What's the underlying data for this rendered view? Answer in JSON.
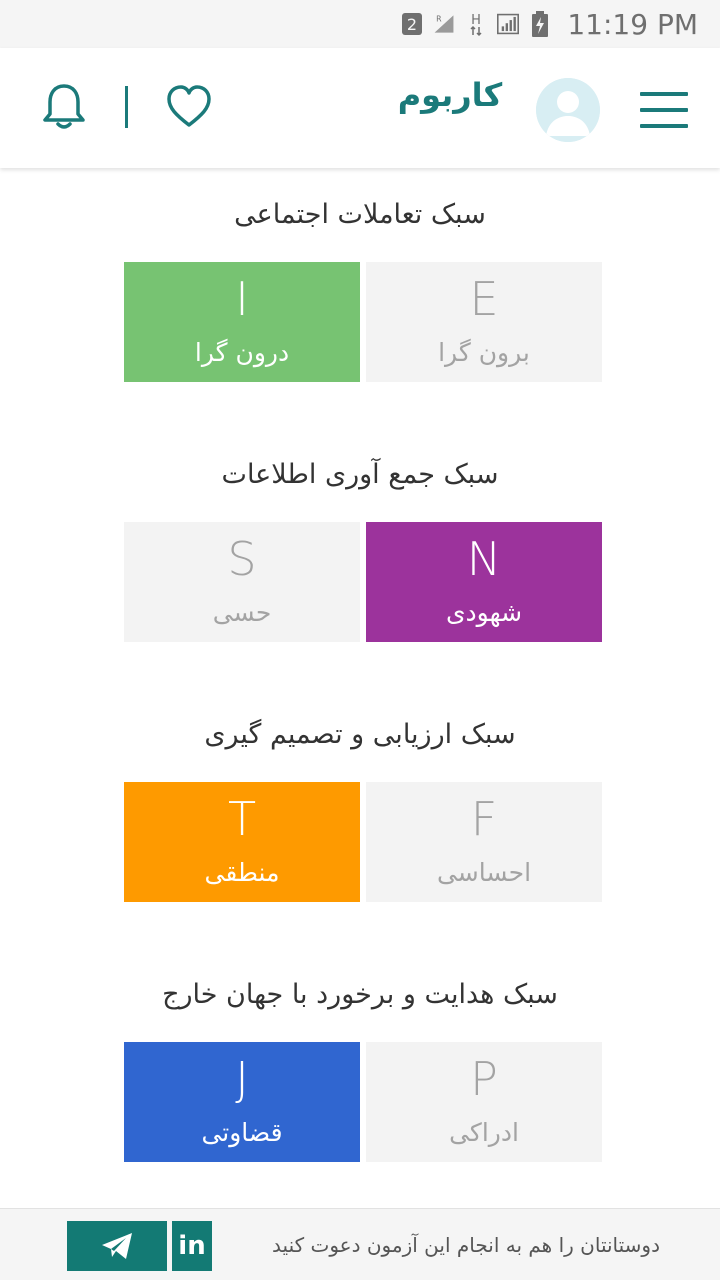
{
  "status_bar": {
    "sim_badge": "2",
    "roaming": "R",
    "network": "H",
    "time": "11:19 PM"
  },
  "app_bar": {
    "logo_text": "کاربوم",
    "accent_color": "#1b7a7a"
  },
  "sections": [
    {
      "title": "سبک تعاملات اجتماعی",
      "options": [
        {
          "letter": "I",
          "label": "درون گرا",
          "selected": true,
          "color": "#77c372"
        },
        {
          "letter": "E",
          "label": "برون گرا",
          "selected": false,
          "color": "#f3f3f3"
        }
      ]
    },
    {
      "title": "سبک جمع آوری اطلاعات",
      "options": [
        {
          "letter": "S",
          "label": "حسی",
          "selected": false,
          "color": "#f3f3f3"
        },
        {
          "letter": "N",
          "label": "شهودی",
          "selected": true,
          "color": "#9c339c"
        }
      ]
    },
    {
      "title": "سبک ارزیابی و تصمیم گیری",
      "options": [
        {
          "letter": "T",
          "label": "منطقی",
          "selected": true,
          "color": "#fe9a00"
        },
        {
          "letter": "F",
          "label": "احساسی",
          "selected": false,
          "color": "#f3f3f3"
        }
      ]
    },
    {
      "title": "سبک هدایت و برخورد با جهان خارج",
      "options": [
        {
          "letter": "J",
          "label": "قضاوتی",
          "selected": true,
          "color": "#3066d0"
        },
        {
          "letter": "P",
          "label": "ادراکی",
          "selected": false,
          "color": "#f3f3f3"
        }
      ]
    }
  ],
  "bottom_bar": {
    "invite_text": "دوستانتان را هم به انجام این آزمون دعوت کنید",
    "linkedin_label": "in",
    "button_color": "#137a74"
  }
}
